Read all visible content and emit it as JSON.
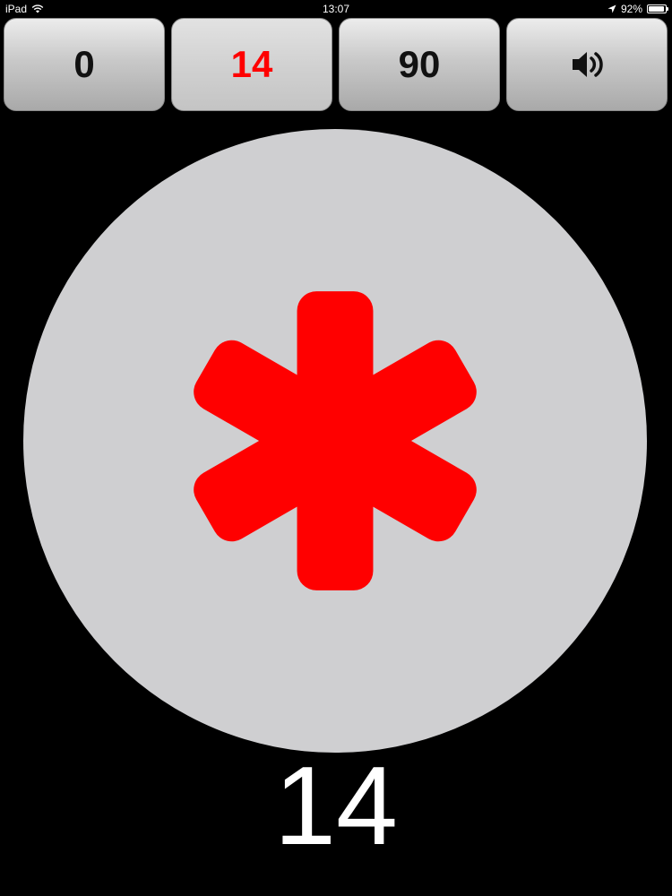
{
  "status_bar": {
    "device": "iPad",
    "wifi_icon": "wifi-icon",
    "time": "13:07",
    "location_icon": "location-arrow-icon",
    "battery_text": "92%",
    "battery_level": 0.92
  },
  "toolbar": {
    "buttons": [
      {
        "label": "0",
        "active": false
      },
      {
        "label": "14",
        "active": true
      },
      {
        "label": "90",
        "active": false
      },
      {
        "icon": "speaker-icon",
        "active": false
      }
    ],
    "text_color": "#111111",
    "active_text_color": "#ff0000"
  },
  "display": {
    "circle_color": "#cfcfd1",
    "symbol_icon": "asterisk-icon",
    "symbol_color": "#ff0000",
    "value": "14"
  }
}
